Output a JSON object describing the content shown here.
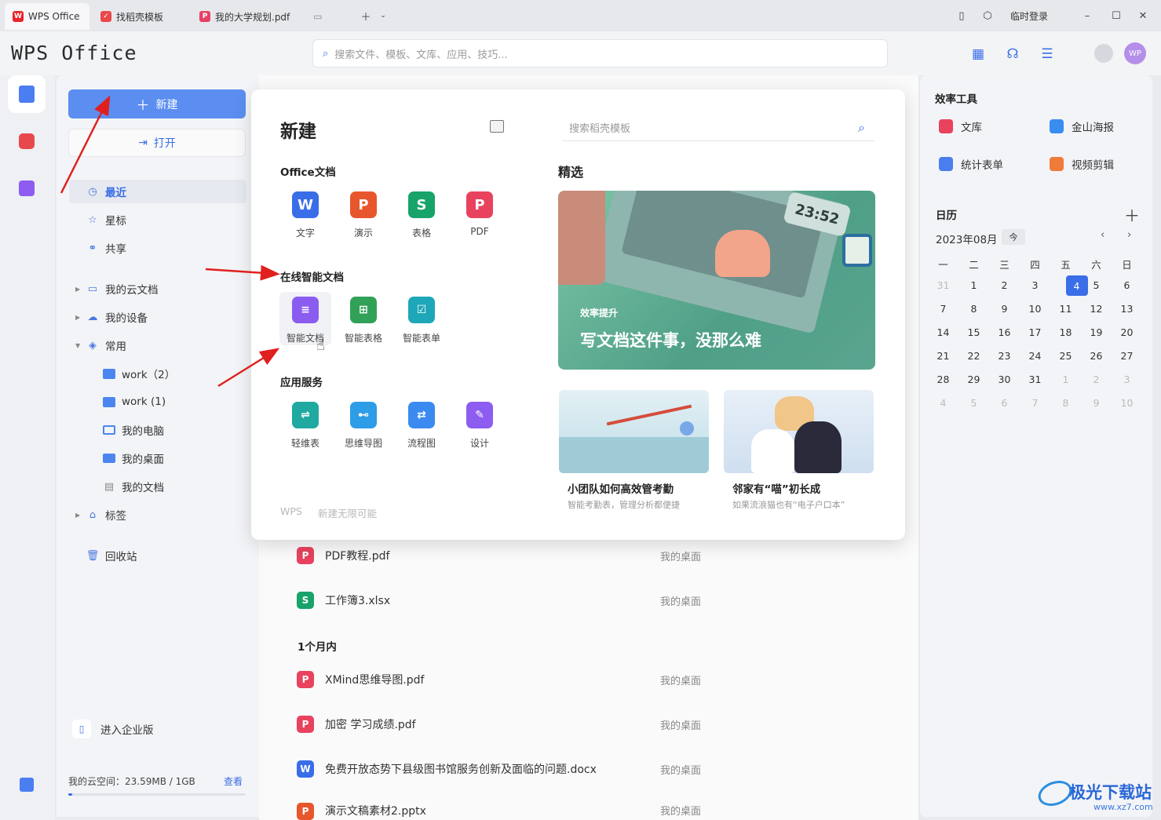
{
  "tabs": [
    {
      "label": "WPS Office",
      "icon": "wps-logo-icon",
      "color": "#e8242b"
    },
    {
      "label": "找稻壳模板",
      "icon": "docer-icon",
      "color": "#e8474c"
    },
    {
      "label": "我的大学规划.pdf",
      "icon": "pdf-icon",
      "color": "#e54167"
    }
  ],
  "titlebar": {
    "login": "临时登录"
  },
  "header": {
    "logo": "WPS Office",
    "search_placeholder": "搜索文件、模板、文库、应用、技巧...",
    "avatar": "WP"
  },
  "sidebar": {
    "new_label": "新建",
    "open_label": "打开",
    "nav": [
      {
        "label": "最近"
      },
      {
        "label": "星标"
      },
      {
        "label": "共享"
      }
    ],
    "tree": [
      {
        "label": "我的云文档"
      },
      {
        "label": "我的设备"
      },
      {
        "label": "常用"
      },
      {
        "label": "work（2）"
      },
      {
        "label": "work (1)"
      },
      {
        "label": "我的电脑"
      },
      {
        "label": "我的桌面"
      },
      {
        "label": "我的文档"
      },
      {
        "label": "标签"
      }
    ],
    "trash": "回收站",
    "enterprise": "进入企业版",
    "storage": "我的云空间：23.59MB / 1GB",
    "storage_fraction": 0.023,
    "view": "查看"
  },
  "newpanel": {
    "title": "新建",
    "template_search": "搜索稻壳模板",
    "office_heading": "Office文档",
    "office_apps": [
      {
        "label": "文字",
        "glyph": "W",
        "color": "#3a6ee8"
      },
      {
        "label": "演示",
        "glyph": "P",
        "color": "#e8562d"
      },
      {
        "label": "表格",
        "glyph": "S",
        "color": "#18a36a"
      },
      {
        "label": "PDF",
        "glyph": "P",
        "color": "#e8425e"
      }
    ],
    "online_heading": "在线智能文档",
    "online_apps": [
      {
        "label": "智能文档",
        "color": "#8b5cf0"
      },
      {
        "label": "智能表格",
        "color": "#31a157"
      },
      {
        "label": "智能表单",
        "color": "#1ea7b8"
      }
    ],
    "services_heading": "应用服务",
    "service_apps": [
      {
        "label": "轻维表",
        "color": "#1fa9a0"
      },
      {
        "label": "思维导图",
        "color": "#2d9de8"
      },
      {
        "label": "流程图",
        "color": "#3b8af0"
      },
      {
        "label": "设计",
        "color": "#8d5cf0"
      }
    ],
    "footer_brand": "WPS",
    "footer_slogan": "新建无限可能",
    "featured_heading": "精选",
    "banner_tag": "效率提升",
    "banner_title": "写文档这件事，没那么难",
    "banner_clock": "23:52",
    "cards": [
      {
        "title": "小团队如何高效管考勤",
        "subtitle": "智能考勤表，管理分析都便捷"
      },
      {
        "title": "邻家有“喵”初长成",
        "subtitle": "如果流浪猫也有“电子户口本”"
      }
    ]
  },
  "files": [
    {
      "name": "PDF教程.pdf",
      "location": "我的桌面",
      "glyph": "P",
      "color": "#e8425e"
    },
    {
      "name": "工作簿3.xlsx",
      "location": "我的桌面",
      "glyph": "S",
      "color": "#18a36a"
    },
    {
      "name": "XMind思维导图.pdf",
      "location": "我的桌面",
      "glyph": "P",
      "color": "#e8425e"
    },
    {
      "name": "加密 学习成绩.pdf",
      "location": "我的桌面",
      "glyph": "P",
      "color": "#e8425e"
    },
    {
      "name": "免费开放态势下县级图书馆服务创新及面临的问题.docx",
      "location": "我的桌面",
      "glyph": "W",
      "color": "#3a6ee8"
    },
    {
      "name": "演示文稿素材2.pptx",
      "location": "我的桌面",
      "glyph": "P",
      "color": "#e8562d"
    }
  ],
  "group_heading": "1个月内",
  "right": {
    "tools_heading": "效率工具",
    "tools": [
      {
        "label": "文库",
        "color": "#e8425e"
      },
      {
        "label": "金山海报",
        "color": "#3a8df0"
      },
      {
        "label": "统计表单",
        "color": "#4a7ef0"
      },
      {
        "label": "视频剪辑",
        "color": "#f07a3a"
      }
    ],
    "calendar_heading": "日历",
    "month": "2023年08月",
    "today_btn": "今",
    "weekdays": [
      "一",
      "二",
      "三",
      "四",
      "五",
      "六",
      "日"
    ],
    "weeks": [
      [
        "31",
        "1",
        "2",
        "3",
        "4",
        "5",
        "6"
      ],
      [
        "7",
        "8",
        "9",
        "10",
        "11",
        "12",
        "13"
      ],
      [
        "14",
        "15",
        "16",
        "17",
        "18",
        "19",
        "20"
      ],
      [
        "21",
        "22",
        "23",
        "24",
        "25",
        "26",
        "27"
      ],
      [
        "28",
        "29",
        "30",
        "31",
        "1",
        "2",
        "3"
      ],
      [
        "4",
        "5",
        "6",
        "7",
        "8",
        "9",
        "10"
      ]
    ],
    "selected_day": "4"
  },
  "watermark": {
    "title": "极光下载站",
    "url": "www.xz7.com"
  },
  "accent": "#3a6ee8"
}
